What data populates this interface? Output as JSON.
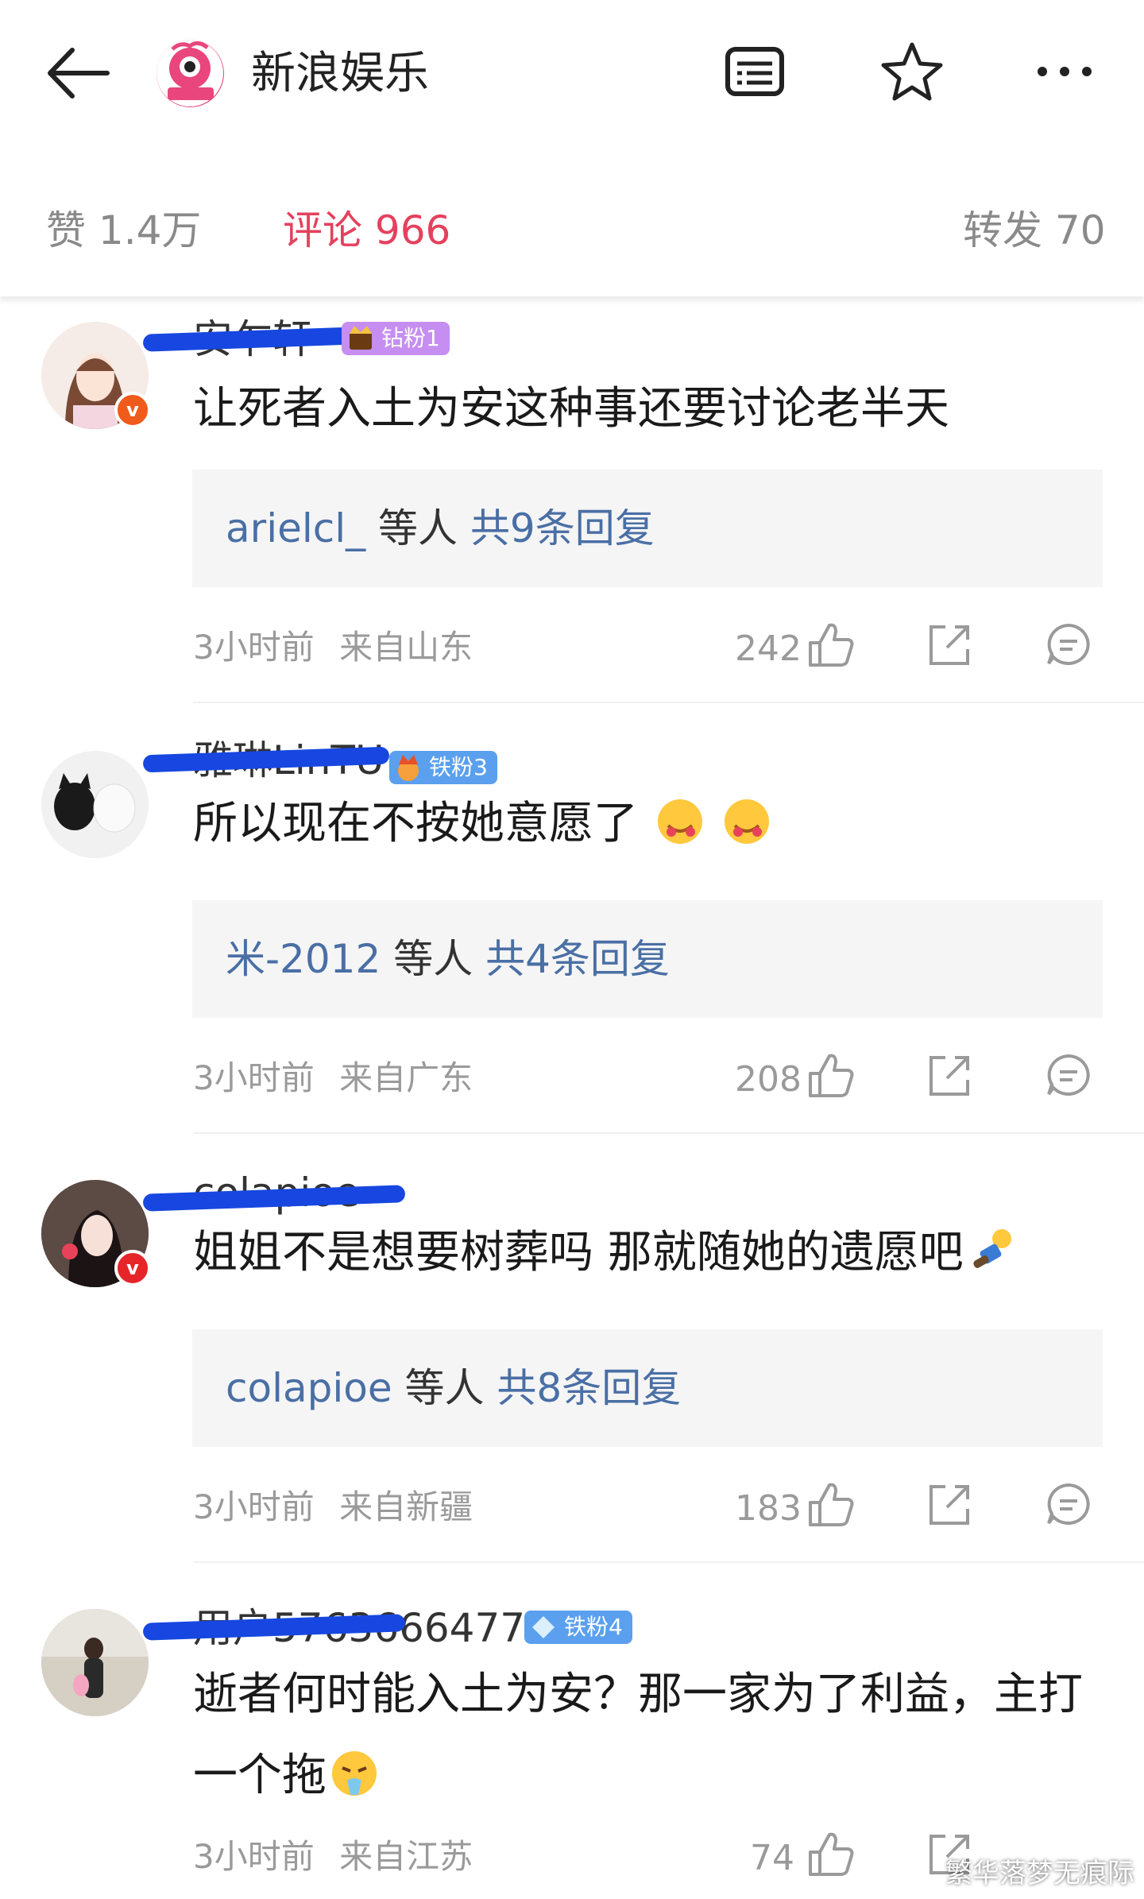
{
  "header": {
    "title": "新浪娱乐",
    "back_icon": "back-arrow-icon",
    "reader_icon": "reader-mode-icon",
    "star_icon": "star-icon",
    "more_icon": "more-icon"
  },
  "tabs": {
    "likes": "赞 1.4万",
    "comments": "评论 966",
    "reposts": "转发 70"
  },
  "colors": {
    "accent": "#e4415d",
    "link": "#4a6fa5",
    "muted": "#9a9a9a"
  },
  "comments": [
    {
      "username": "安乍轩",
      "fan_badge": "钻粉1",
      "text": "让死者入土为安这种事还要讨论老半天",
      "reply_user": "arielcl_",
      "reply_mid": "等人",
      "reply_count": "共9条回复",
      "time": "3小时前",
      "location": "来自山东",
      "likes": "242"
    },
    {
      "username": "雅琳LinTU",
      "fan_badge": "铁粉3",
      "text": "所以现在不按她意愿了",
      "reply_user": "米-2012",
      "reply_mid": "等人",
      "reply_count": "共4条回复",
      "time": "3小时前",
      "location": "来自广东",
      "likes": "208"
    },
    {
      "username": "colapioe",
      "text": "姐姐不是想要树葬吗 那就随她的遗愿吧",
      "reply_user": "colapioe",
      "reply_mid": "等人",
      "reply_count": "共8条回复",
      "time": "3小时前",
      "location": "来自新疆",
      "likes": "183"
    },
    {
      "username": "用户5763666477",
      "fan_badge": "铁粉4",
      "text_line1": "逝者何时能入土为安？那一家为了利益，主打",
      "text_line2": "一个拖",
      "time": "3小时前",
      "location": "来自江苏",
      "likes": "74"
    }
  ],
  "watermark": "繁华落梦无痕际"
}
